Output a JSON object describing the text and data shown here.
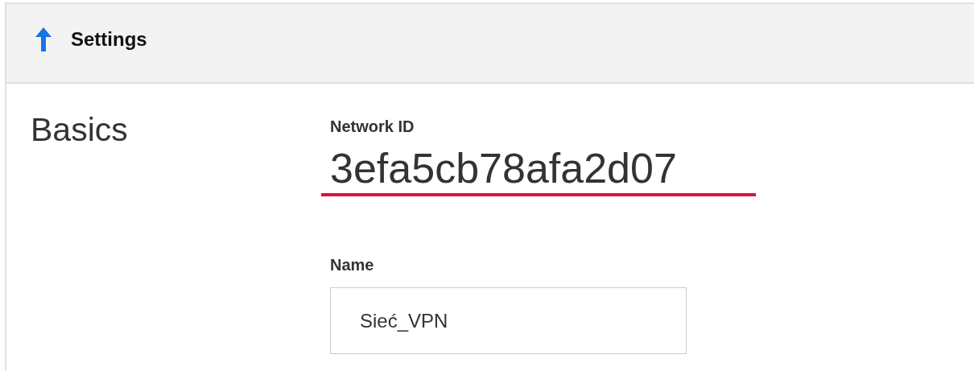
{
  "header": {
    "title": "Settings"
  },
  "section": {
    "title": "Basics"
  },
  "network_id": {
    "label": "Network ID",
    "value": "3efa5cb78afa2d07"
  },
  "name": {
    "label": "Name",
    "value": "Sieć_VPN"
  }
}
